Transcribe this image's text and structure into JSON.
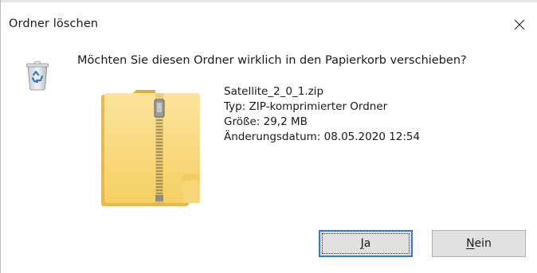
{
  "window": {
    "title": "Ordner löschen",
    "close_glyph": "✕"
  },
  "message": {
    "question": "Möchten Sie diesen Ordner wirklich in den Papierkorb verschieben?"
  },
  "file": {
    "name": "Satellite_2_0_1.zip",
    "type_line": "Typ: ZIP-komprimierter Ordner",
    "size_line": "Größe: 29,2 MB",
    "modified_line": "Änderungsdatum: 08.05.2020 12:54"
  },
  "buttons": {
    "yes": {
      "mnemonic": "J",
      "rest": "a"
    },
    "no": {
      "mnemonic": "N",
      "rest": "ein"
    }
  },
  "icons": {
    "dialog_icon": "recycle-bin-icon",
    "file_icon": "zip-folder-icon"
  },
  "colors": {
    "accent_focus": "#2c7be0",
    "folder_yellow": "#f8d774",
    "button_bg": "#e1e1e1"
  }
}
